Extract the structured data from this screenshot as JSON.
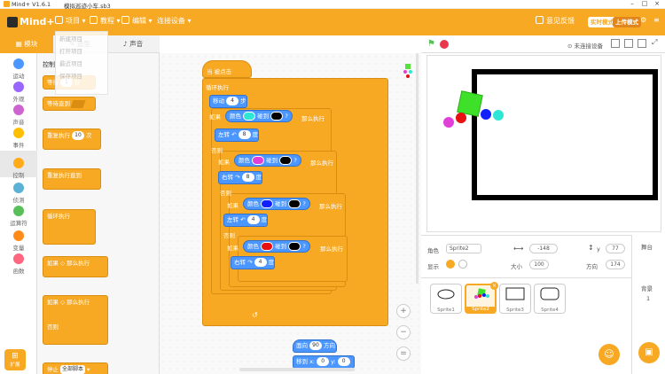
{
  "title_bar": {
    "app_name": "Mind+ V1.6.1",
    "file_name": "模拟巡迹小车.sb3"
  },
  "menu": {
    "logo_text": "Mind+",
    "items": [
      {
        "label": "项目"
      },
      {
        "label": "教程"
      },
      {
        "label": "编辑"
      },
      {
        "label": "连接设备"
      }
    ],
    "feedback": "意见反馈",
    "mode_realtime": "实时模式",
    "mode_upload": "上传模式"
  },
  "file_menu_ghost": [
    "新建项目",
    "打开项目",
    "最近项目",
    "保存项目"
  ],
  "tabs": [
    {
      "label": "模块",
      "active": true
    },
    {
      "label": "造型",
      "active": false
    },
    {
      "label": "声音",
      "active": false
    }
  ],
  "categories": [
    {
      "label": "运动",
      "color": "#4c97ff"
    },
    {
      "label": "外观",
      "color": "#9966ff"
    },
    {
      "label": "声音",
      "color": "#cf63cf"
    },
    {
      "label": "事件",
      "color": "#ffbf00"
    },
    {
      "label": "控制",
      "color": "#ffab19",
      "selected": true
    },
    {
      "label": "侦测",
      "color": "#5cb1d6"
    },
    {
      "label": "运算符",
      "color": "#59c059"
    },
    {
      "label": "变量",
      "color": "#ff8c1a"
    },
    {
      "label": "函数",
      "color": "#ff6680"
    }
  ],
  "extension_label": "扩展",
  "palette": {
    "section_title": "控制",
    "blocks": [
      {
        "label": "等待",
        "value": "1",
        "suffix": "秒"
      },
      {
        "label": "等待直到"
      },
      {
        "label": "重复执行",
        "value": "10",
        "suffix": "次"
      },
      {
        "label": "重复执行直到"
      },
      {
        "label": "循环执行"
      },
      {
        "label": "如果",
        "suffix": "那么执行"
      },
      {
        "label": "如果",
        "suffix": "那么执行"
      },
      {
        "label": "否则"
      },
      {
        "label": "停止",
        "value": "全部脚本"
      }
    ]
  },
  "script": {
    "hat": "当 被点击",
    "forever": "循环执行",
    "move": {
      "label": "移动",
      "value": "4",
      "suffix": "步"
    },
    "if1": {
      "label": "如果",
      "cond": "颜色",
      "touch": "碰到",
      "q": "?",
      "then": "那么执行",
      "color1": "#2ee6d6",
      "color2": "#000000"
    },
    "turn_left1": {
      "label": "左转",
      "value": "8",
      "suffix": "度"
    },
    "else1": "否则",
    "if2": {
      "label": "如果",
      "cond": "颜色",
      "touch": "碰到",
      "q": "?",
      "then": "那么执行",
      "color1": "#e040d8",
      "color2": "#000000"
    },
    "turn_right1": {
      "label": "右转",
      "value": "8",
      "suffix": "度"
    },
    "else2": "否则",
    "if3": {
      "label": "如果",
      "cond": "颜色",
      "touch": "碰到",
      "q": "?",
      "then": "那么执行",
      "color1": "#1020ff",
      "color2": "#000000"
    },
    "turn_left2": {
      "label": "左转",
      "value": "4",
      "suffix": "度"
    },
    "else3": "否则",
    "if4": {
      "label": "如果",
      "cond": "颜色",
      "touch": "碰到",
      "q": "?",
      "then": "那么执行",
      "color1": "#e81010",
      "color2": "#000000"
    },
    "turn_right2": {
      "label": "右转",
      "value": "4",
      "suffix": "度"
    },
    "point": {
      "label": "面向",
      "value": "90",
      "suffix": "方向"
    },
    "goto": {
      "label": "移到 x:",
      "x": "0",
      "ylabel": "y:",
      "y": "0"
    }
  },
  "stage_header": {
    "status": "未连接设备"
  },
  "sprite_info": {
    "sprite_label": "角色",
    "sprite_name": "Sprite2",
    "x_value": "-148",
    "y_label": "y",
    "y_value": "77",
    "show_label": "显示",
    "size_label": "大小",
    "size_value": "100",
    "dir_label": "方向",
    "dir_value": "174"
  },
  "sprites": [
    {
      "name": "Sprite1",
      "selected": false
    },
    {
      "name": "Sprite2",
      "selected": true
    },
    {
      "name": "Sprite3",
      "selected": false
    },
    {
      "name": "Sprite4",
      "selected": false
    }
  ],
  "stage_panel": {
    "title": "舞台",
    "backdrop_label": "背景",
    "backdrop_count": "1"
  }
}
